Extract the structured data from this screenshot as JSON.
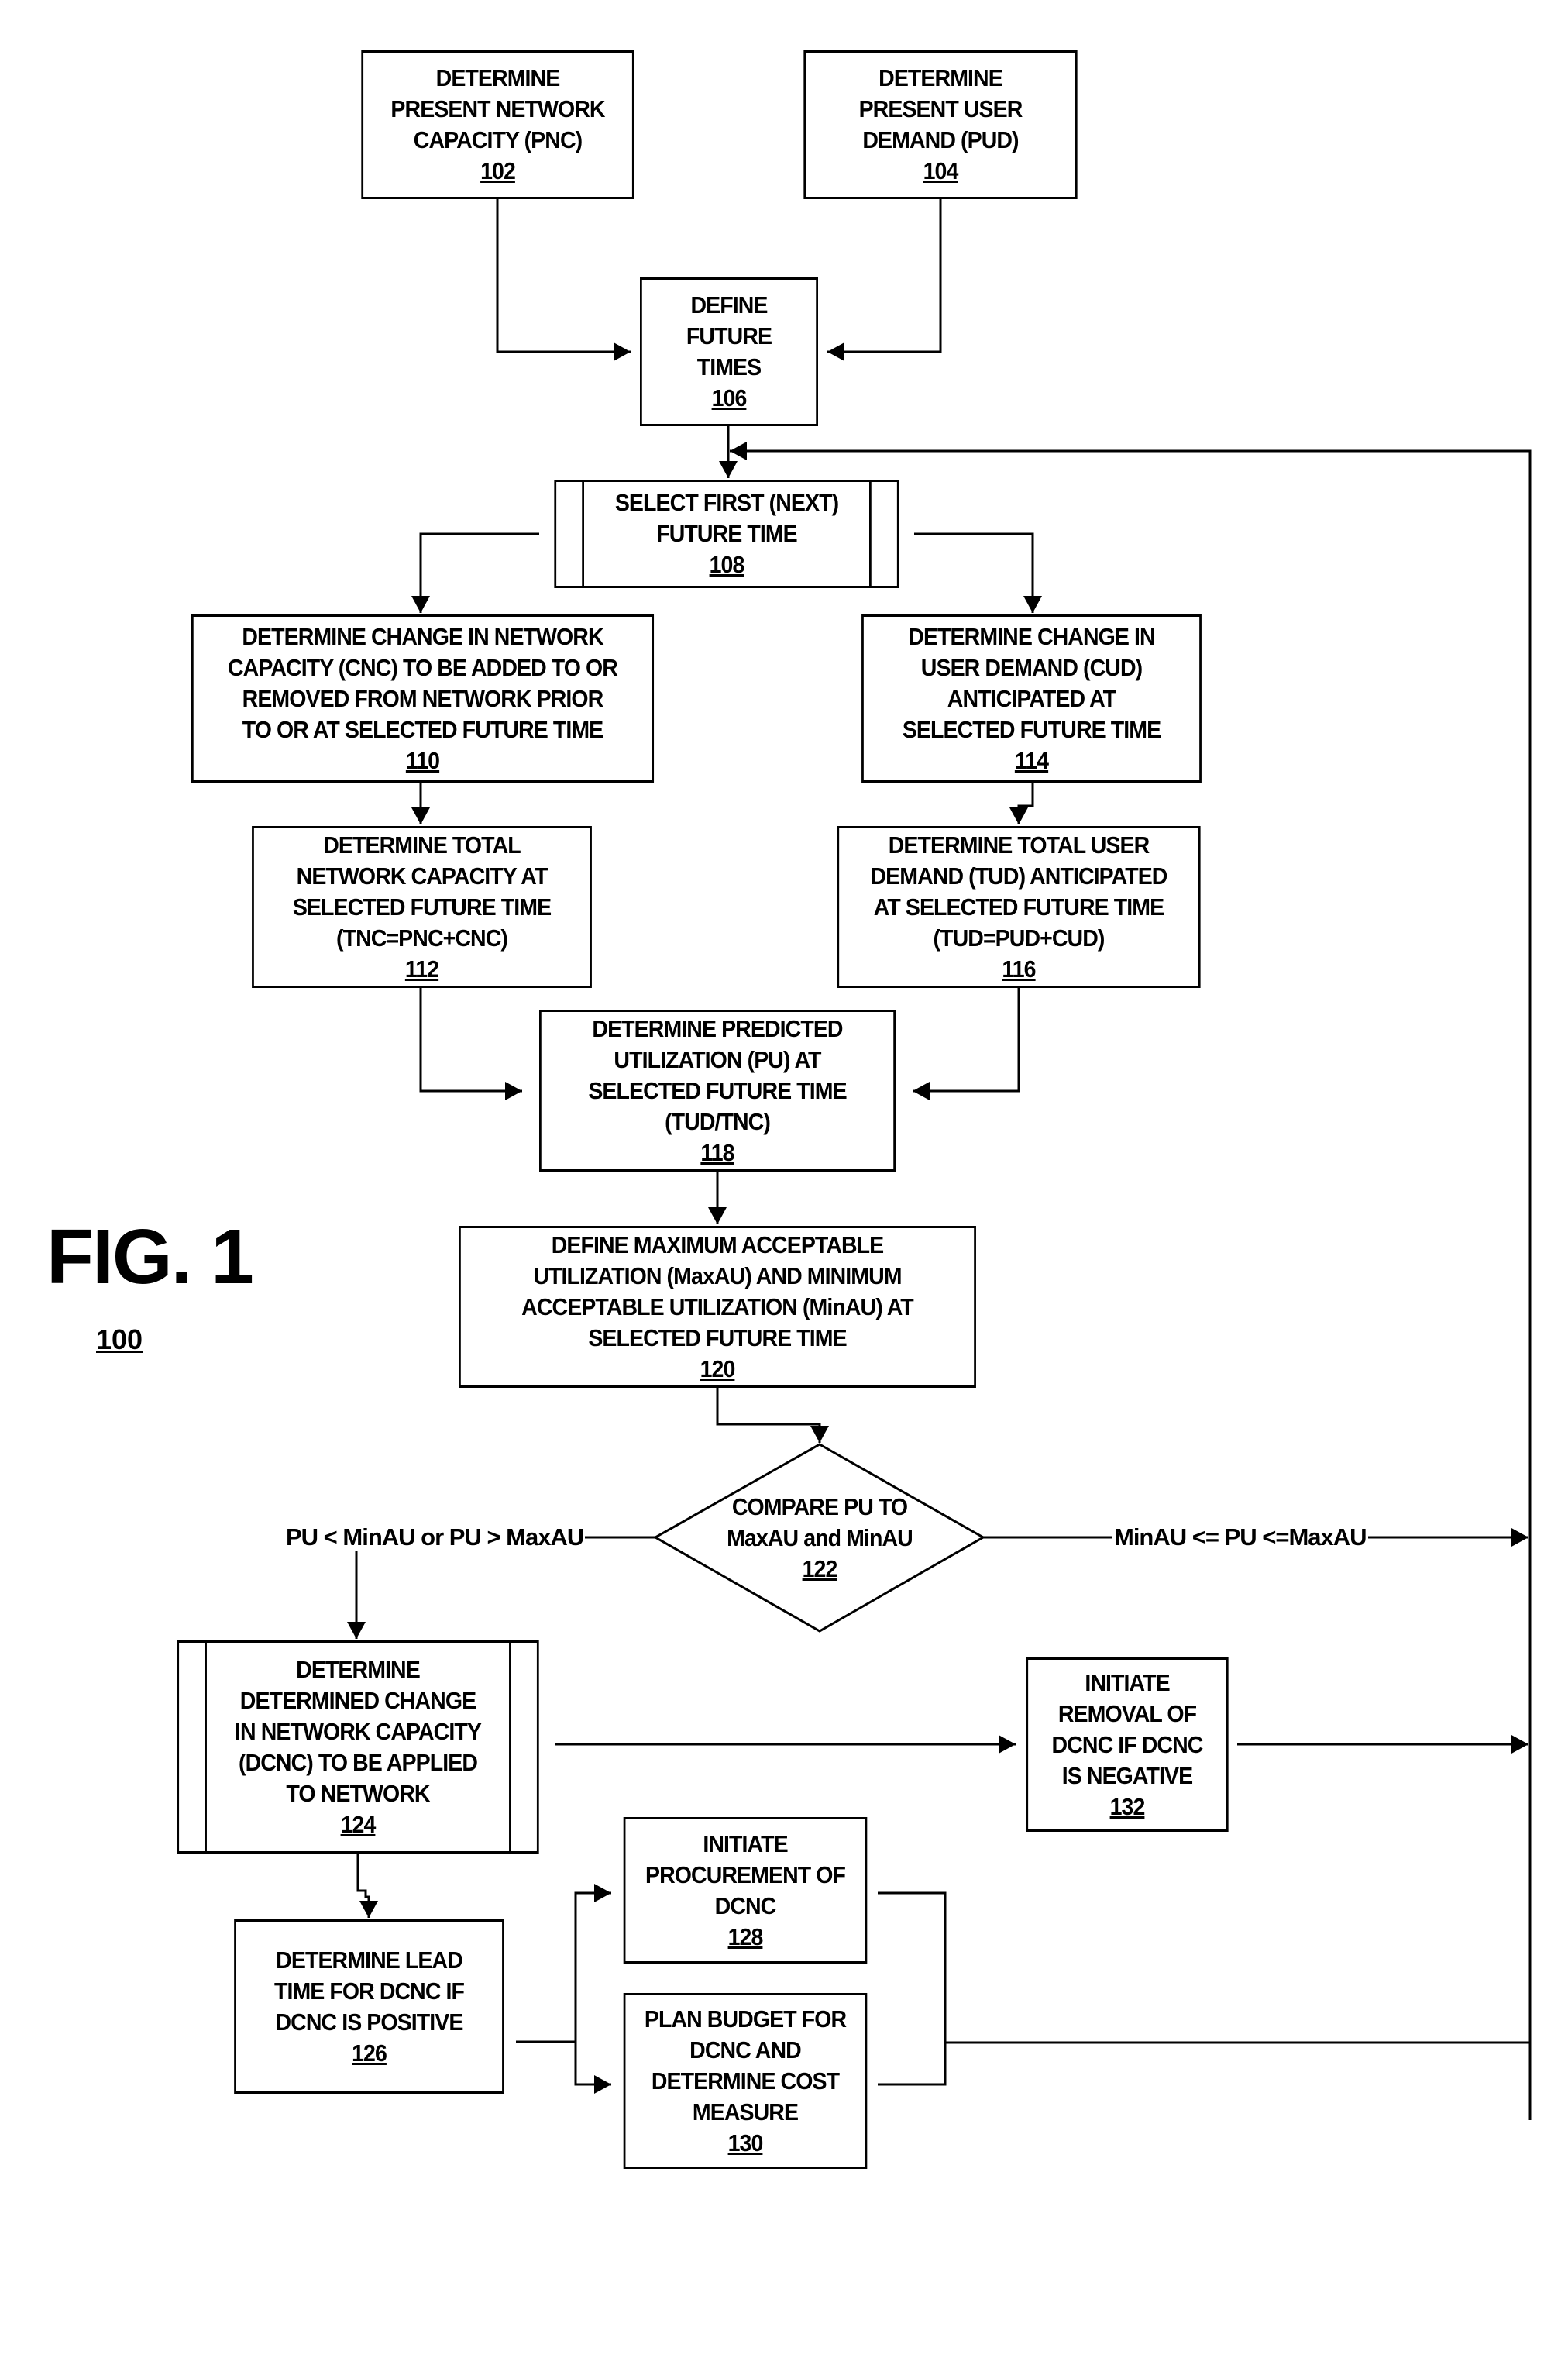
{
  "figure": {
    "title": "FIG. 1",
    "number": "100"
  },
  "steps": {
    "s102": {
      "lines": [
        "DETERMINE",
        "PRESENT NETWORK",
        "CAPACITY (PNC)"
      ],
      "ref": "102"
    },
    "s104": {
      "lines": [
        "DETERMINE",
        "PRESENT USER",
        "DEMAND (PUD)"
      ],
      "ref": "104"
    },
    "s106": {
      "lines": [
        "DEFINE",
        "FUTURE",
        "TIMES"
      ],
      "ref": "106"
    },
    "s108": {
      "lines": [
        "SELECT FIRST (NEXT)",
        "FUTURE TIME"
      ],
      "ref": "108"
    },
    "s110": {
      "lines": [
        "DETERMINE CHANGE IN NETWORK",
        "CAPACITY (CNC) TO BE ADDED TO OR",
        "REMOVED FROM NETWORK PRIOR",
        "TO OR AT SELECTED FUTURE TIME"
      ],
      "ref": "110"
    },
    "s112": {
      "lines": [
        "DETERMINE TOTAL",
        "NETWORK CAPACITY AT",
        "SELECTED FUTURE TIME",
        "(TNC=PNC+CNC)"
      ],
      "ref": "112"
    },
    "s114": {
      "lines": [
        "DETERMINE CHANGE IN",
        "USER DEMAND (CUD)",
        "ANTICIPATED AT",
        "SELECTED FUTURE TIME"
      ],
      "ref": "114"
    },
    "s116": {
      "lines": [
        "DETERMINE TOTAL USER",
        "DEMAND (TUD) ANTICIPATED",
        "AT SELECTED FUTURE TIME",
        "(TUD=PUD+CUD)"
      ],
      "ref": "116"
    },
    "s118": {
      "lines": [
        "DETERMINE PREDICTED",
        "UTILIZATION (PU) AT",
        "SELECTED FUTURE TIME",
        "(TUD/TNC)"
      ],
      "ref": "118"
    },
    "s120": {
      "lines": [
        "DEFINE MAXIMUM ACCEPTABLE",
        "UTILIZATION (MaxAU) AND MINIMUM",
        "ACCEPTABLE UTILIZATION (MinAU) AT",
        "SELECTED FUTURE TIME"
      ],
      "ref": "120"
    },
    "s122": {
      "lines": [
        "COMPARE PU TO",
        "MaxAU and MinAU"
      ],
      "ref": "122"
    },
    "s124": {
      "lines": [
        "DETERMINE",
        "DETERMINED CHANGE",
        "IN NETWORK CAPACITY",
        "(DCNC) TO BE APPLIED",
        "TO NETWORK"
      ],
      "ref": "124"
    },
    "s126": {
      "lines": [
        "DETERMINE LEAD",
        "TIME FOR DCNC IF",
        "DCNC IS POSITIVE"
      ],
      "ref": "126"
    },
    "s128": {
      "lines": [
        "INITIATE",
        "PROCUREMENT OF",
        "DCNC"
      ],
      "ref": "128"
    },
    "s130": {
      "lines": [
        "PLAN BUDGET FOR",
        "DCNC AND",
        "DETERMINE COST",
        "MEASURE"
      ],
      "ref": "130"
    },
    "s132": {
      "lines": [
        "INITIATE",
        "REMOVAL OF",
        "DCNC IF DCNC",
        "IS NEGATIVE"
      ],
      "ref": "132"
    }
  },
  "edge_labels": {
    "out_of_range": "PU < MinAU or PU > MaxAU",
    "in_range": "MinAU <= PU <=MaxAU"
  }
}
